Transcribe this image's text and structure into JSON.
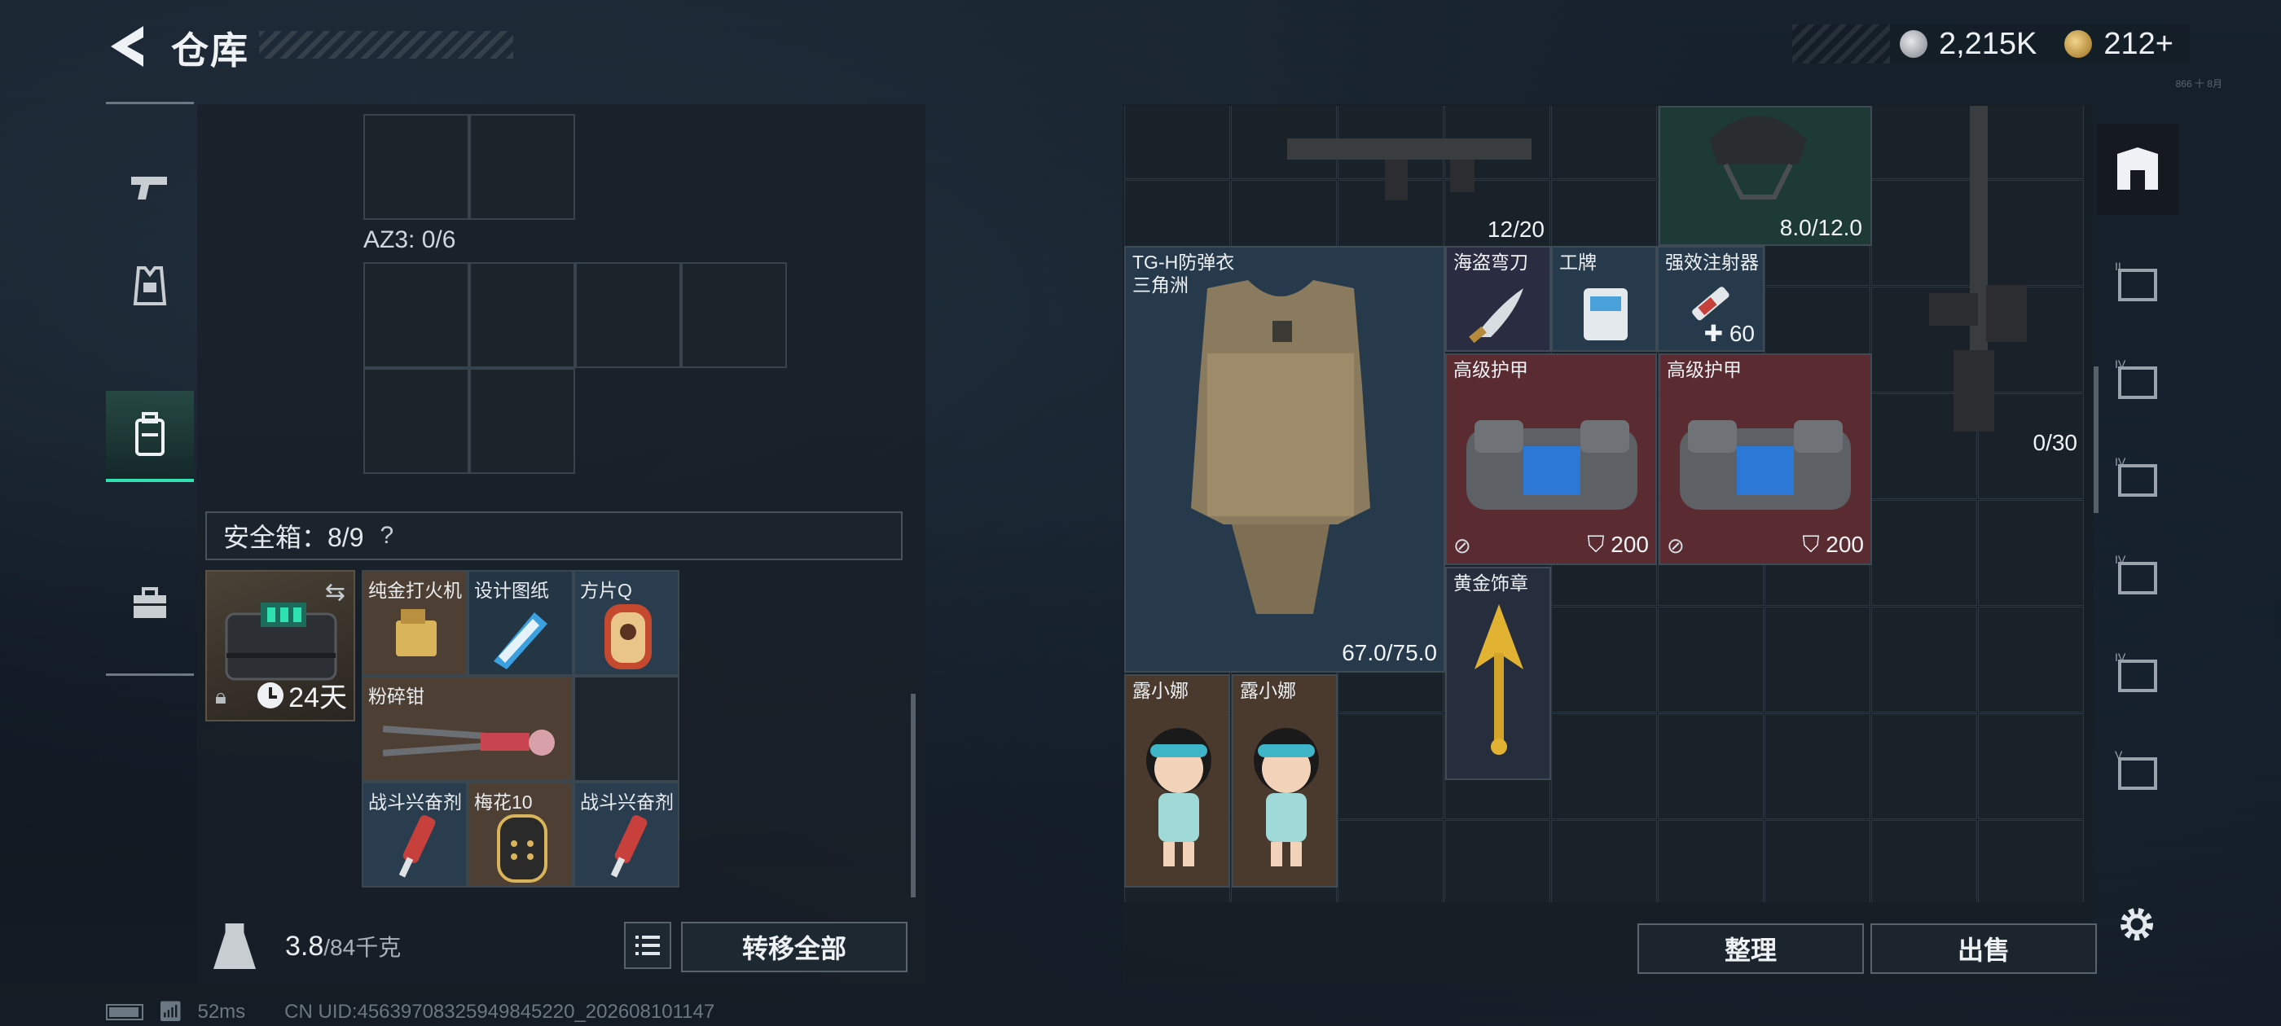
{
  "header": {
    "title": "仓库",
    "currency_silver": "2,215K",
    "currency_gold": "212+",
    "hint": "866 十 8月"
  },
  "left": {
    "az3_label": "AZ3: 0/6",
    "safebox_label": "安全箱：8/9",
    "help": "?",
    "safebox_timer": "24天",
    "items": [
      {
        "name": "纯金打火机"
      },
      {
        "name": "设计图纸"
      },
      {
        "name": "方片Q"
      },
      {
        "name": "粉碎钳"
      },
      {
        "name": "战斗兴奋剂"
      },
      {
        "name": "梅花10"
      },
      {
        "name": "战斗兴奋剂"
      }
    ],
    "weight_current": "3.8",
    "weight_max": "/84千克",
    "transfer_all": "转移全部"
  },
  "right": {
    "top_counts": [
      "12/20",
      "8.0/12.0"
    ],
    "vest_name": "TG-H防弹衣",
    "vest_sub": "三角洲",
    "vest_durability": "67.0/75.0",
    "pirate_knife": "海盗弯刀",
    "badge": "工牌",
    "injector": "强效注射器",
    "injector_count": "60",
    "armor1_name": "高级护甲",
    "armor1_value": "200",
    "armor2_name": "高级护甲",
    "armor2_value": "200",
    "gold_badge": "黄金饰章",
    "luna1": "露小娜",
    "luna2": "露小娜",
    "rifle_ammo": "0/30",
    "sort_label": "整理",
    "sell_label": "出售"
  },
  "footer": {
    "ping": "52ms",
    "uid": "CN UID:4563970832594984522​0_202608101147"
  },
  "colors": {
    "accent": "#2fe0b0",
    "red_slot": "#5a2b30",
    "blue_slot": "#263a4b",
    "brown_slot": "#4a3a2d"
  }
}
